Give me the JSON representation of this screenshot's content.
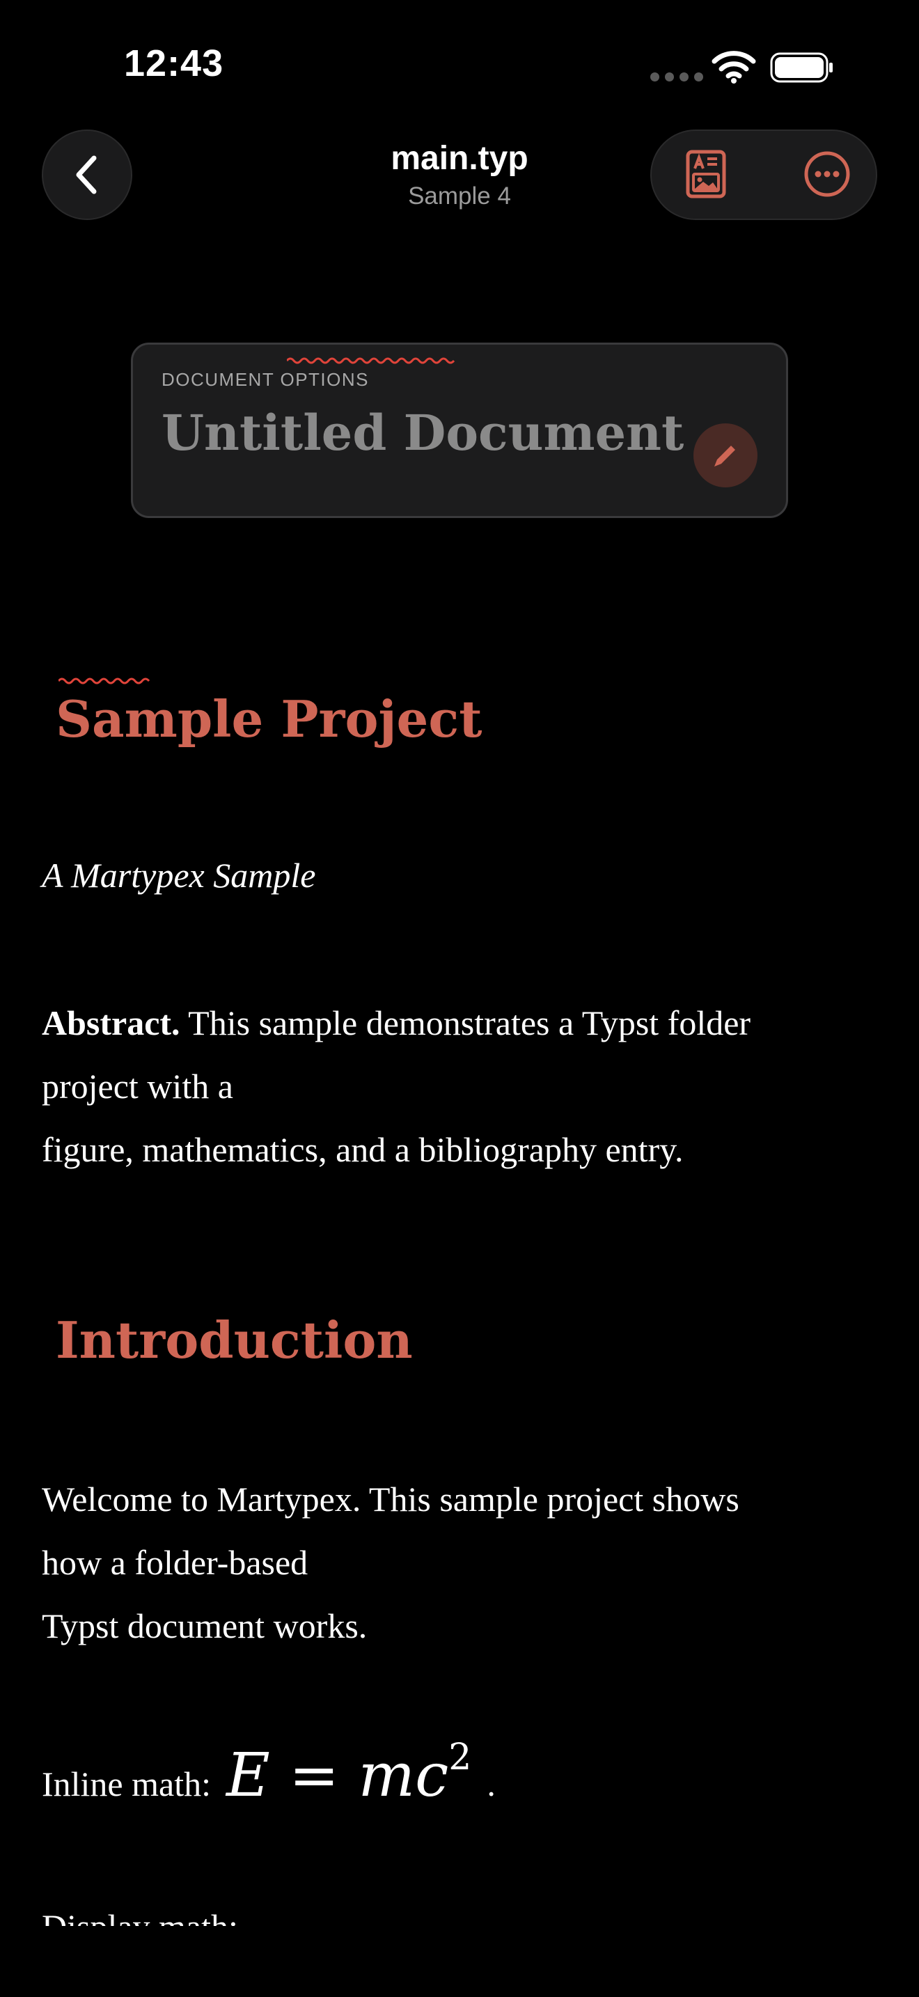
{
  "status_bar": {
    "time": "12:43"
  },
  "nav": {
    "title": "main.typ",
    "subtitle": "Sample 4"
  },
  "options_card": {
    "label": "DOCUMENT OPTIONS",
    "title": "Untitled Document"
  },
  "document": {
    "title": "Sample Project",
    "subtitle": "A Martypex Sample",
    "abstract_bold": "Abstract.",
    "abstract_line1": "This sample demonstrates a Typst folder",
    "abstract_line2": "project with a",
    "abstract_line3": "figure, mathematics, and a bibliography entry.",
    "section_intro": "Introduction",
    "intro_line1": "Welcome to Martypex. This sample project shows",
    "intro_line2": "how a folder-based",
    "intro_line3": "Typst document works.",
    "inline_math_label": "Inline math:",
    "math_lhs": "E",
    "math_eq": "=",
    "math_rhs": "mc",
    "math_exp": "2",
    "math_end": ".",
    "display_math_partial": "Display math:"
  },
  "colors": {
    "accent": "#cf6655",
    "background": "#000000",
    "card": "#1c1c1d"
  },
  "icons": [
    "chevron-left-icon",
    "document-preview-icon",
    "more-icon",
    "pencil-icon",
    "wifi-icon",
    "battery-icon"
  ]
}
